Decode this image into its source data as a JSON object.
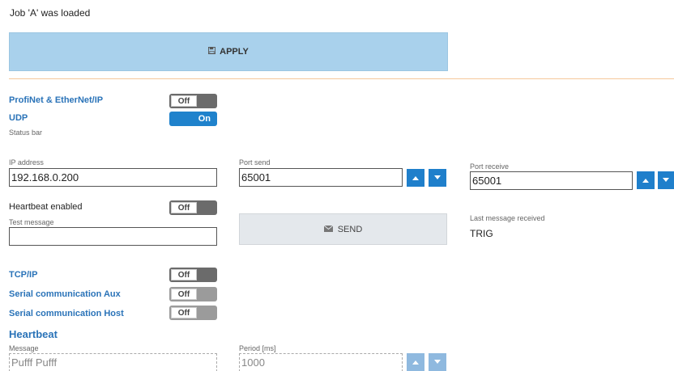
{
  "status": {
    "message": "Job 'A' was loaded"
  },
  "apply": {
    "label": "APPLY",
    "icon": "save-icon"
  },
  "protocols": {
    "profinet": {
      "label": "ProfiNet & EtherNet/IP",
      "state": "Off"
    },
    "udp": {
      "label": "UDP",
      "state": "On",
      "sublabel": "Status bar"
    },
    "tcp": {
      "label": "TCP/IP",
      "state": "Off"
    },
    "serial_aux": {
      "label": "Serial communication Aux",
      "state": "Off"
    },
    "serial_host": {
      "label": "Serial communication Host",
      "state": "Off"
    }
  },
  "udp_settings": {
    "ip_label": "IP address",
    "ip_value": "192.168.0.200",
    "port_send_label": "Port send",
    "port_send_value": "65001",
    "port_receive_label": "Port receive",
    "port_receive_value": "65001",
    "heartbeat_label": "Heartbeat enabled",
    "heartbeat_state": "Off",
    "test_message_label": "Test message",
    "test_message_value": "",
    "send_label": "SEND",
    "send_icon": "envelope-icon",
    "last_message_label": "Last message received",
    "last_message_value": "TRIG"
  },
  "heartbeat": {
    "heading": "Heartbeat",
    "message_label": "Message",
    "message_value": "Pufff Pufff",
    "period_label": "Period [ms]",
    "period_value": "1000"
  },
  "colors": {
    "accent": "#1f82cc",
    "label_blue": "#2a73b8",
    "apply_bg": "#a9d1ec",
    "divider": "#f5c89a"
  }
}
